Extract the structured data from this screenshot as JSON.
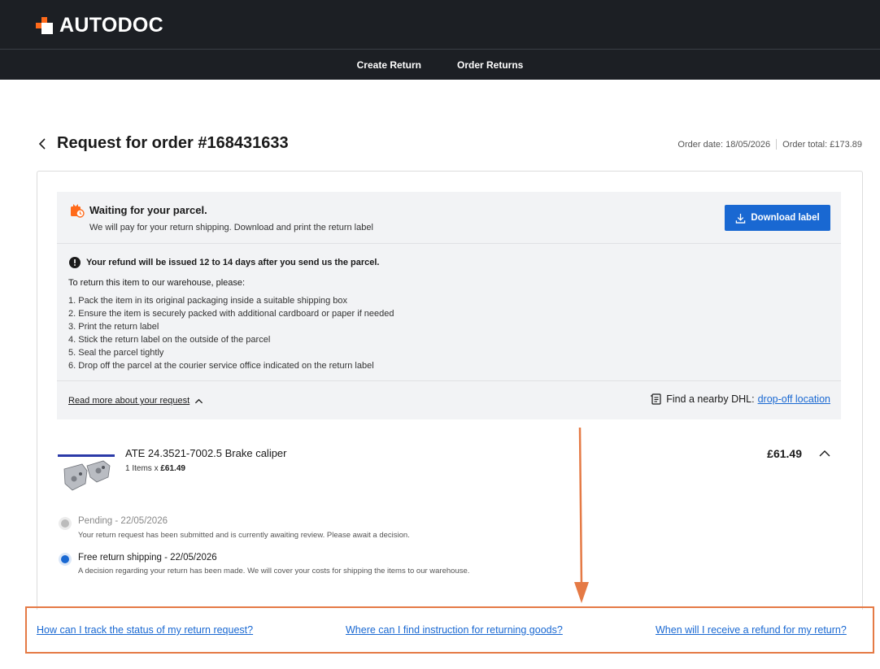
{
  "brand": {
    "name": "AUTODOC",
    "accent": "#ff6a1a",
    "header_bg": "#1c1f24",
    "link_color": "#1968d2"
  },
  "nav": {
    "create_return": "Create Return",
    "order_returns": "Order Returns"
  },
  "page": {
    "title": "Request for order #168431633",
    "order_date": "Order date: 18/05/2026",
    "order_total": "Order total: £173.89"
  },
  "status": {
    "title": "Waiting for your parcel.",
    "subtitle": "We will pay for your return shipping. Download and print the return label",
    "download_label": "Download label"
  },
  "instructions": {
    "refund_note": "Your refund will be issued 12 to 14 days after you send us the parcel.",
    "title": "To return this item to our warehouse, please:",
    "steps": [
      "1. Pack the item in its original packaging inside a suitable shipping box",
      "2. Ensure the item is securely packed with additional cardboard or paper if needed",
      "3. Print the return label",
      "4. Stick the return label on the outside of the parcel",
      "5. Seal the parcel tightly",
      "6. Drop off the parcel at the courier service office indicated on the return label"
    ]
  },
  "footer_panel": {
    "read_more": "Read more about your request",
    "dhl_text": "Find a nearby DHL:",
    "dhl_link": "drop-off location"
  },
  "product": {
    "name": "ATE 24.3521-7002.5 Brake caliper",
    "qty_text": "1 Items x ",
    "qty_price": "£61.49",
    "price": "£61.49"
  },
  "timeline": [
    {
      "title": "Pending - 22/05/2026",
      "desc": "Your return request has been submitted and is currently awaiting review. Please await a decision."
    },
    {
      "title": "Free return shipping - 22/05/2026",
      "desc": "A decision regarding your return has been made. We will cover your costs for shipping the items to our warehouse."
    }
  ],
  "faq": [
    "How can I track the status of my return request?",
    "Where can I find instruction for returning goods?",
    "When will I receive a refund for my return?"
  ],
  "annotation": {
    "color": "#e57a45"
  }
}
